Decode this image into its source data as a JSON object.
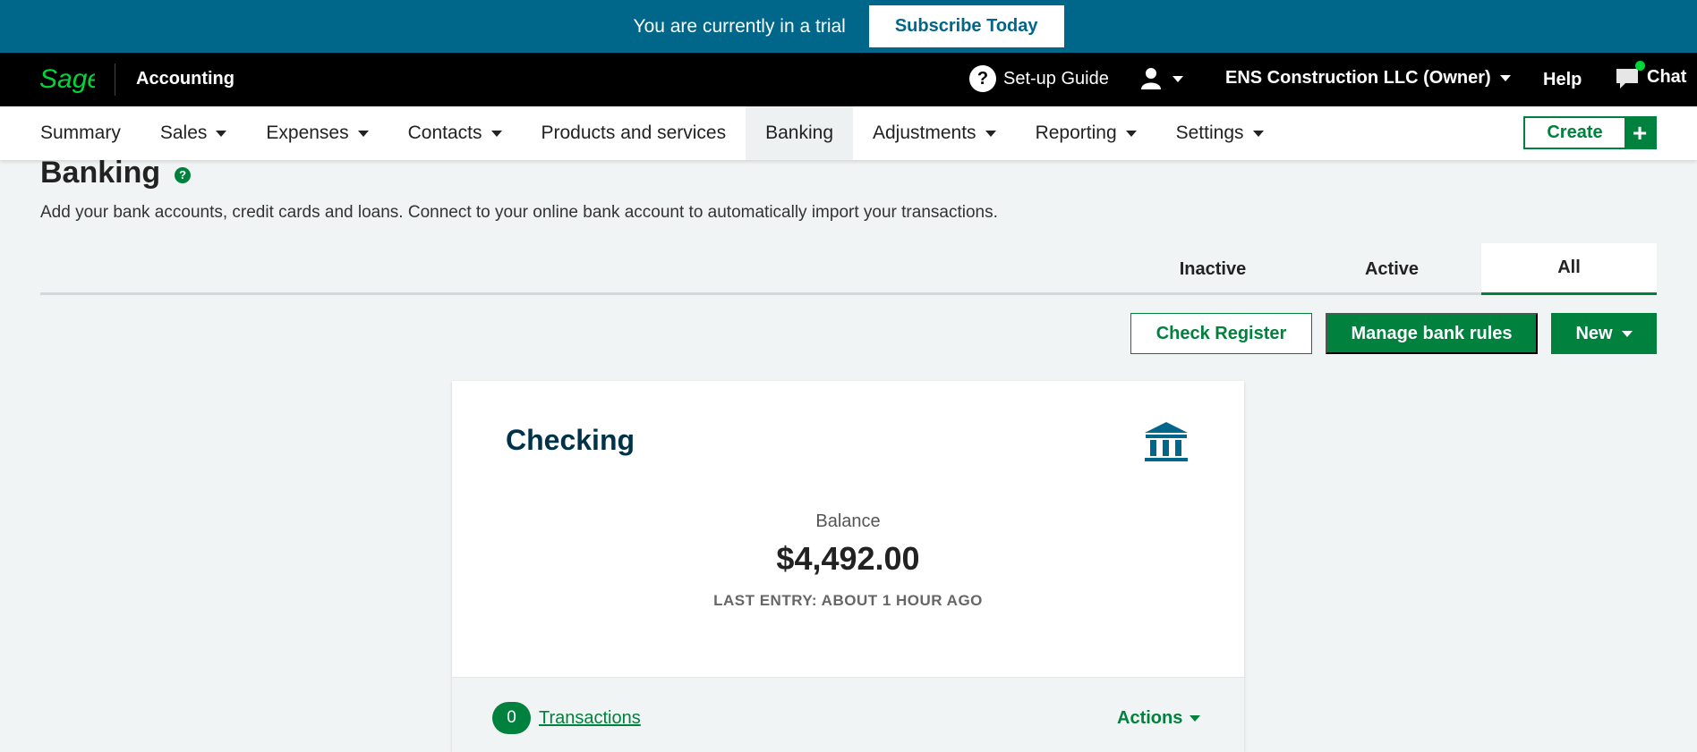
{
  "trial_bar": {
    "message": "You are currently in a trial",
    "subscribe_label": "Subscribe Today"
  },
  "top_nav": {
    "logo_text": "Sage",
    "app_name": "Accounting",
    "setup_guide_label": "Set-up Guide",
    "company_label": "ENS Construction LLC (Owner)",
    "help_label": "Help",
    "chat_label": "Chat"
  },
  "main_nav": {
    "items": [
      {
        "label": "Summary"
      },
      {
        "label": "Sales"
      },
      {
        "label": "Expenses"
      },
      {
        "label": "Contacts"
      },
      {
        "label": "Products and services"
      },
      {
        "label": "Banking"
      },
      {
        "label": "Adjustments"
      },
      {
        "label": "Reporting"
      },
      {
        "label": "Settings"
      }
    ],
    "create_label": "Create"
  },
  "page": {
    "title": "Banking",
    "description": "Add your bank accounts, credit cards and loans. Connect to your online bank account to automatically import your transactions.",
    "tabs": [
      {
        "label": "Inactive"
      },
      {
        "label": "Active"
      },
      {
        "label": "All"
      }
    ],
    "buttons": {
      "check_register": "Check Register",
      "manage_bank_rules": "Manage bank rules",
      "new": "New"
    }
  },
  "account_card": {
    "name": "Checking",
    "balance_label": "Balance",
    "balance_value": "$4,492.00",
    "last_entry": "LAST ENTRY: ABOUT 1 HOUR AGO",
    "transactions_count": "0",
    "transactions_label": "Transactions",
    "actions_label": "Actions"
  },
  "colors": {
    "trial_bar": "#00668a",
    "brand_green": "#00813d",
    "sage_logo_green": "#00d639",
    "card_title": "#003349"
  }
}
